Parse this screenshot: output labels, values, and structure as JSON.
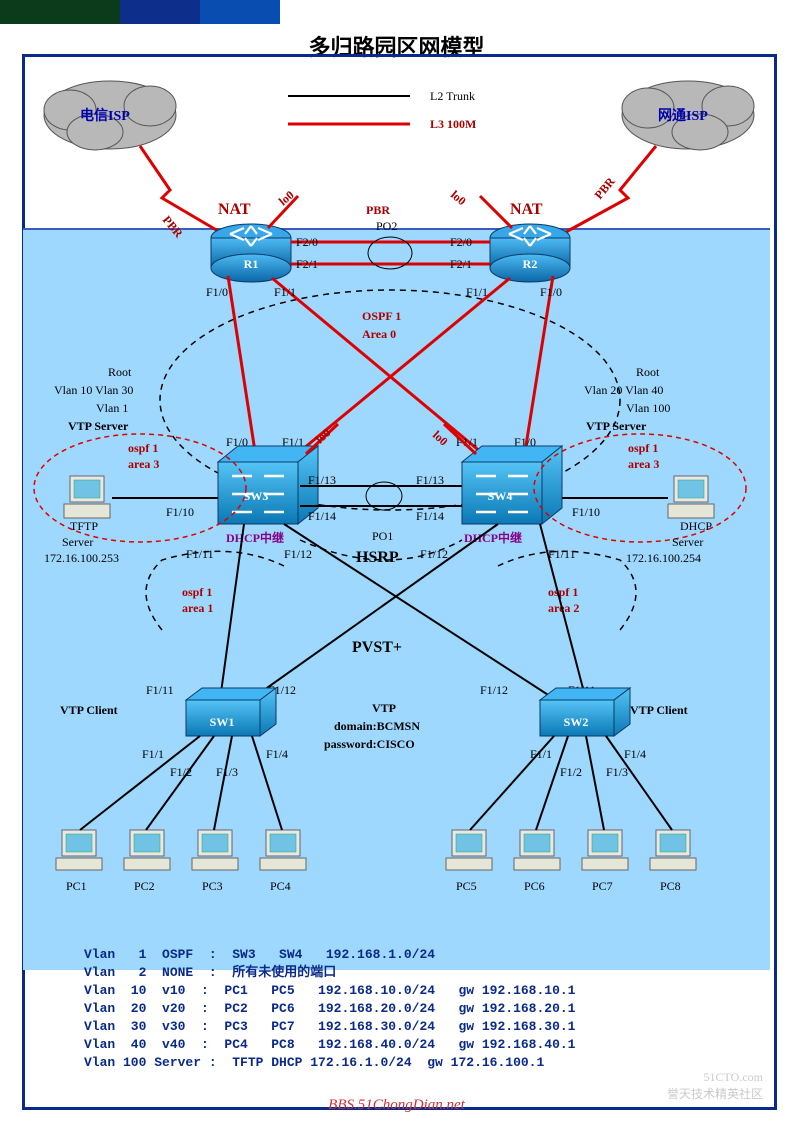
{
  "title": "多归路园区网模型",
  "legend": {
    "l2": "L2 Trunk",
    "l3": "L3 100M"
  },
  "clouds": {
    "left": "电信ISP",
    "right": "网通ISP"
  },
  "routers": {
    "r1": {
      "name": "R1",
      "nat": "NAT",
      "pbr": "PBR",
      "lo0": "lo0",
      "f10": "F1/0",
      "f11": "F1/1",
      "f20": "F2/0",
      "f21": "F2/1"
    },
    "r2": {
      "name": "R2",
      "nat": "NAT",
      "pbr": "PBR",
      "lo0": "lo0",
      "f10": "F1/0",
      "f11": "F1/1",
      "f20": "F2/0",
      "f21": "F2/1"
    },
    "po2": "PO2",
    "pbr_mid": "PBR"
  },
  "ospf_core": {
    "l1": "OSPF 1",
    "l2": "Area 0"
  },
  "core_switches": {
    "sw3": {
      "name": "SW3",
      "root": "Root",
      "vlans1": "Vlan 10 Vlan 30",
      "vlans2": "Vlan 1",
      "vtp": "VTP Server",
      "f10": "F1/0",
      "f11l": "F1/1",
      "f111": "F1/11",
      "f112": "F1/12",
      "f113": "F1/13",
      "f114": "F1/14",
      "dhcp": "DHCP中继",
      "lo0": "lo0",
      "srv_port": "F1/10"
    },
    "sw4": {
      "name": "SW4",
      "root": "Root",
      "vlans1": "Vlan 20 Vlan 40",
      "vlans2": "Vlan 100",
      "vtp": "VTP Server",
      "f10": "F1/0",
      "f11l": "F1/1",
      "f111": "F1/11",
      "f112": "F1/12",
      "f113": "F1/13",
      "f114": "F1/14",
      "dhcp": "DHCP中继",
      "lo0": "lo0",
      "srv_port": "F1/10"
    },
    "po1": "PO1",
    "hsrp": "HSRP"
  },
  "ospf_areas": {
    "sw3_srv": {
      "l1": "ospf 1",
      "l2": "area 3"
    },
    "sw4_srv": {
      "l1": "ospf 1",
      "l2": "area 3"
    },
    "left": {
      "l1": "ospf 1",
      "l2": "area 1"
    },
    "right": {
      "l1": "ospf 1",
      "l2": "area 2"
    }
  },
  "servers": {
    "tftp": {
      "l1": "TFTP",
      "l2": "Server",
      "ip": "172.16.100.253"
    },
    "dhcp": {
      "l1": "DHCP",
      "l2": "Server",
      "ip": "172.16.100.254"
    }
  },
  "pvst": "PVST+",
  "vtp_info": {
    "title": "VTP",
    "domain": "domain:BCMSN",
    "password": "password:CISCO"
  },
  "access": {
    "sw1": {
      "name": "SW1",
      "vtp": "VTP Client",
      "up1": "F1/11",
      "up2": "F1/12",
      "p1": "F1/1",
      "p2": "F1/2",
      "p3": "F1/3",
      "p4": "F1/4"
    },
    "sw2": {
      "name": "SW2",
      "vtp": "VTP Client",
      "up1": "F1/11",
      "up2": "F1/12",
      "p1": "F1/1",
      "p2": "F1/2",
      "p3": "F1/3",
      "p4": "F1/4"
    }
  },
  "pcs": {
    "pc1": "PC1",
    "pc2": "PC2",
    "pc3": "PC3",
    "pc4": "PC4",
    "pc5": "PC5",
    "pc6": "PC6",
    "pc7": "PC7",
    "pc8": "PC8"
  },
  "vlan_table": "Vlan   1  OSPF  :  SW3   SW4   192.168.1.0/24\nVlan   2  NONE  :  所有未使用的端口\nVlan  10  v10  :  PC1   PC5   192.168.10.0/24   gw 192.168.10.1\nVlan  20  v20  :  PC2   PC6   192.168.20.0/24   gw 192.168.20.1\nVlan  30  v30  :  PC3   PC7   192.168.30.0/24   gw 192.168.30.1\nVlan  40  v40  :  PC4   PC8   192.168.40.0/24   gw 192.168.40.1\nVlan 100 Server :  TFTP DHCP 172.16.1.0/24  gw 172.16.100.1",
  "watermark": {
    "l1": "51CTO.com",
    "l2": "誉天技术精英社区"
  },
  "bbs": "BBS.51ChongDian.net"
}
